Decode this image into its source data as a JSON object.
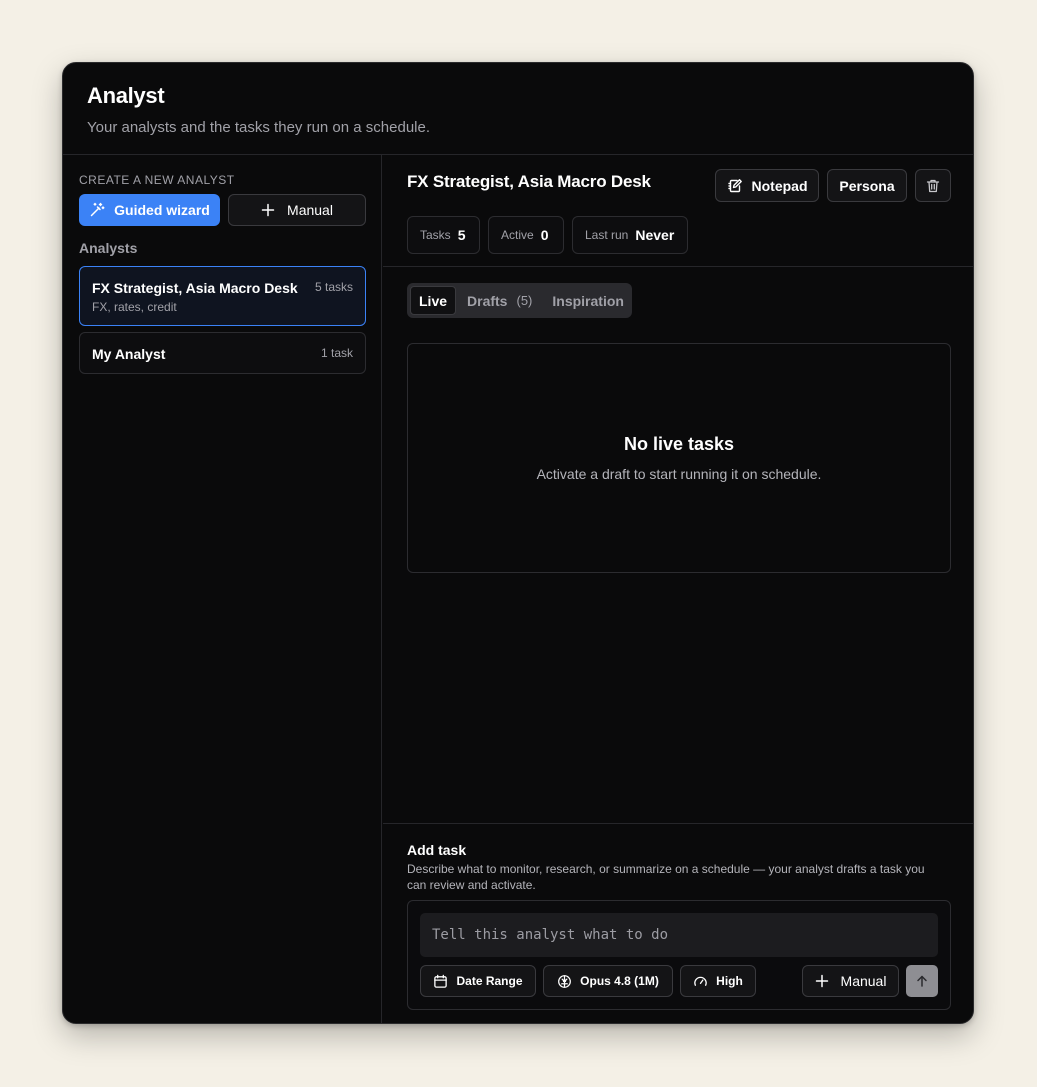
{
  "header": {
    "title": "Analyst",
    "subtitle": "Your analysts and the tasks they run on a schedule."
  },
  "sidebar": {
    "create_label": "CREATE A NEW ANALYST",
    "guided_wizard_label": "Guided wizard",
    "manual_label": "Manual",
    "analysts_label": "Analysts",
    "analysts": [
      {
        "name": "FX Strategist, Asia Macro Desk",
        "count": "5 tasks",
        "description": "FX, rates, credit",
        "selected": true
      },
      {
        "name": "My Analyst",
        "count": "1 task",
        "selected": false
      }
    ]
  },
  "main": {
    "title": "FX Strategist, Asia Macro Desk",
    "notepad_label": "Notepad",
    "persona_label": "Persona",
    "stats": {
      "tasks_label": "Tasks",
      "tasks_value": "5",
      "active_label": "Active",
      "active_value": "0",
      "last_run_label": "Last run",
      "last_run_value": "Never"
    },
    "tabs": {
      "live": "Live",
      "drafts": "Drafts",
      "drafts_count": "(5)",
      "inspiration": "Inspiration",
      "active": "Live"
    },
    "empty": {
      "title": "No live tasks",
      "description": "Activate a draft to start running it on schedule."
    },
    "add_task": {
      "title": "Add task",
      "description": "Describe what to monitor, research, or summarize on a schedule — your analyst drafts a task you can review and activate.",
      "placeholder": "Tell this analyst what to do",
      "value": "",
      "date_range_label": "Date Range",
      "model_label": "Opus 4.8 (1M)",
      "effort_label": "High",
      "manual_label": "Manual"
    }
  },
  "colors": {
    "accent": "#3b82f6",
    "background": "#0a0a0b",
    "page": "#f4f0e6"
  },
  "icons": [
    "wand-icon",
    "plus-icon",
    "notepad-icon",
    "trash-icon",
    "calendar-icon",
    "brain-icon",
    "gauge-icon",
    "arrow-up-icon"
  ]
}
